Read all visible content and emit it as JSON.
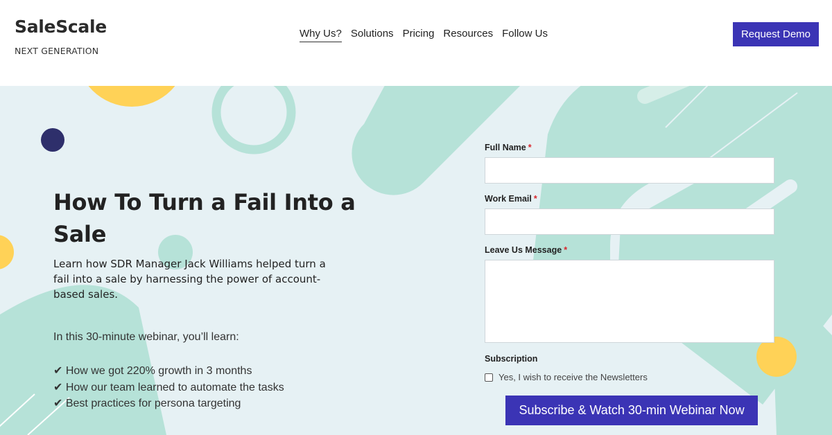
{
  "brand": {
    "name": "SaleScale",
    "tagline": "NEXT GENERATION"
  },
  "nav": {
    "items": [
      "Why Us?",
      "Solutions",
      "Pricing",
      "Resources",
      "Follow Us"
    ],
    "active_index": 0
  },
  "header": {
    "cta_label": "Request Demo"
  },
  "hero": {
    "title": "How To Turn a Fail Into a Sale",
    "lede": "Learn how SDR Manager Jack Williams helped turn a fail into a sale by harnessing the power of account-based sales.",
    "intro": "In this 30-minute webinar, you’ll learn:",
    "bullets": [
      "✔ How we got 220% growth in 3 months",
      "✔ How our team learned to automate the tasks",
      "✔ Best practices for persona targeting"
    ]
  },
  "form": {
    "full_name_label": "Full Name",
    "work_email_label": "Work Email",
    "message_label": "Leave Us Message",
    "required_mark": "*",
    "subscription_label": "Subscription",
    "newsletter_label": "Yes, I wish to receive the Newsletters",
    "submit_label": "Subscribe & Watch 30-min Webinar Now",
    "full_name_value": "",
    "work_email_value": "",
    "message_value": ""
  },
  "colors": {
    "accent": "#3b34b5",
    "hero_bg": "#e6f1f4",
    "mint": "#b6e2d8",
    "yellow": "#ffd257",
    "navy": "#2e2f6b",
    "required": "#d9262c"
  },
  "icons": {
    "bullet": "check-mark-icon"
  }
}
